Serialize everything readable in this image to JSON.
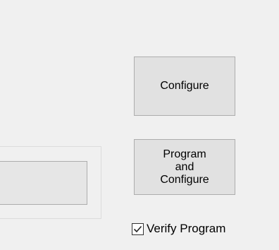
{
  "buttons": {
    "configure_label": "Configure",
    "program_label": "Program\nand\nConfigure"
  },
  "verify": {
    "label": "Verify Program",
    "checked": true
  },
  "colors": {
    "background": "#f0f0f0",
    "button_face": "#e1e1e1",
    "button_border": "#adadad"
  },
  "icons": {
    "checkbox": "check-icon"
  }
}
